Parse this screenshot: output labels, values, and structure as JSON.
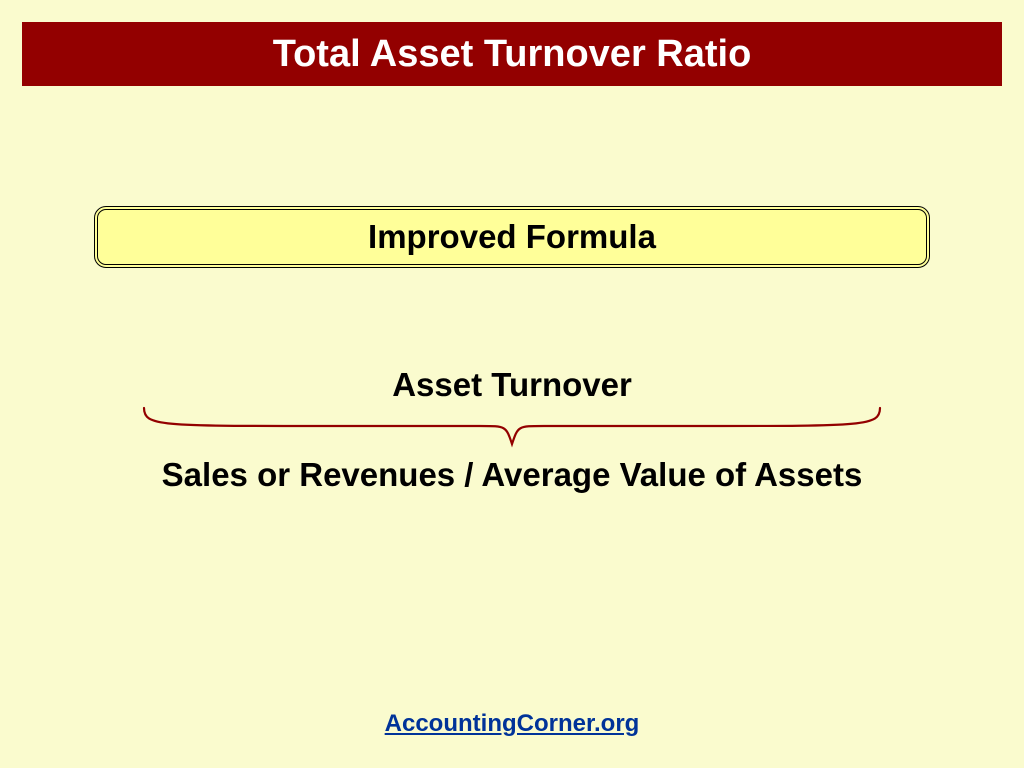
{
  "header": {
    "title": "Total Asset Turnover Ratio"
  },
  "box": {
    "label": "Improved Formula"
  },
  "concept": {
    "name": "Asset Turnover",
    "formula": "Sales or Revenues / Average Value of Assets"
  },
  "footer": {
    "link_text": "AccountingCorner.org"
  },
  "colors": {
    "background": "#fafbce",
    "banner": "#930000",
    "box_fill": "#ffff99",
    "brace": "#930000",
    "link": "#003399"
  }
}
